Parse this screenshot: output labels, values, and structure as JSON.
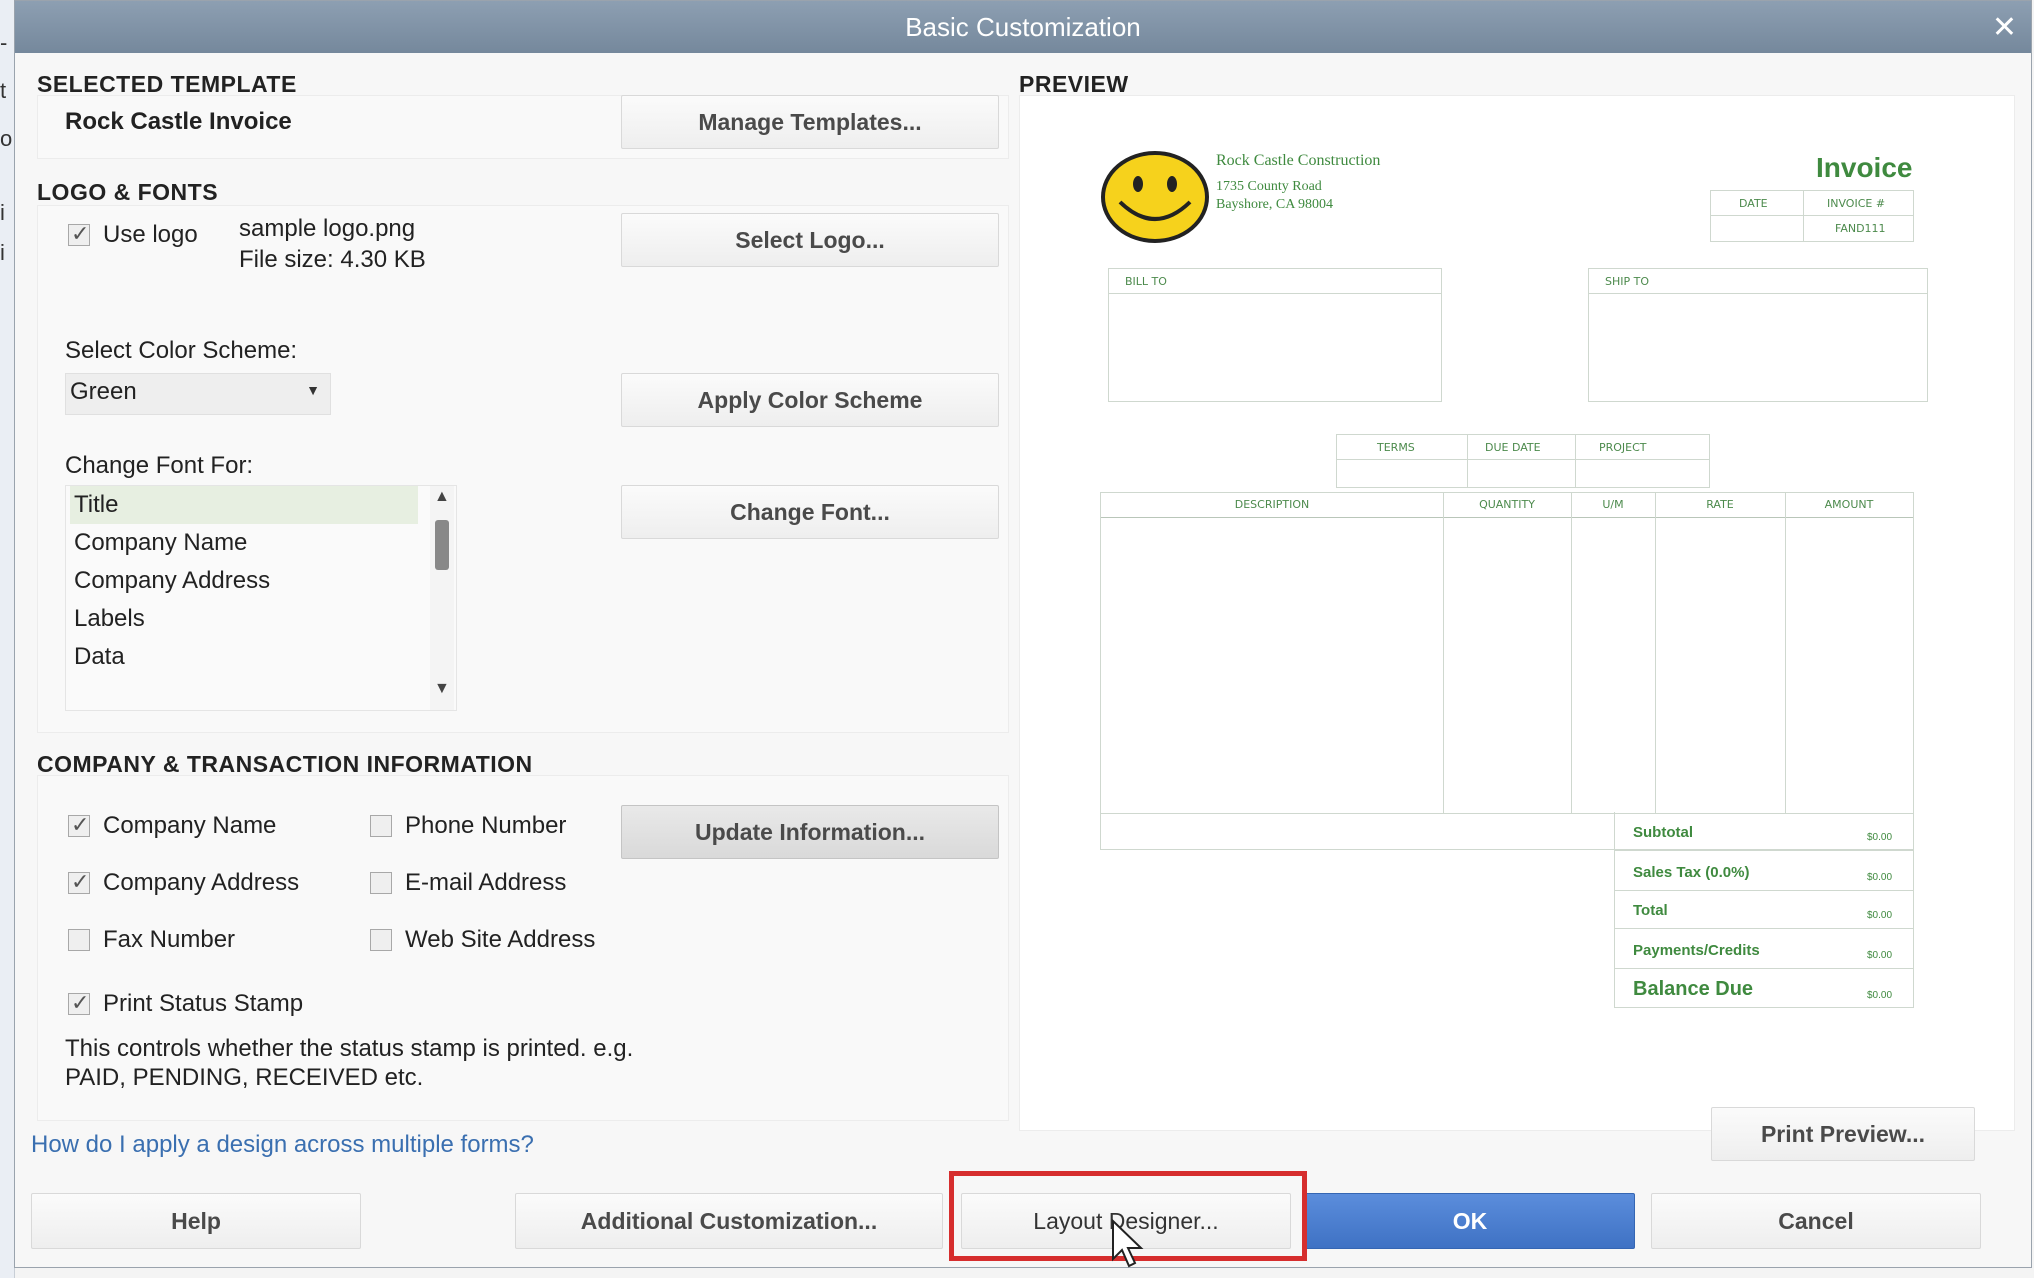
{
  "window": {
    "title": "Basic Customization"
  },
  "selected_template": {
    "heading": "SELECTED TEMPLATE",
    "name": "Rock Castle Invoice",
    "manage_button": "Manage Templates..."
  },
  "logo_fonts": {
    "heading": "LOGO & FONTS",
    "use_logo_label": "Use logo",
    "use_logo_checked": true,
    "logo_file": "sample logo.png",
    "logo_size": "File size: 4.30 KB",
    "select_logo_button": "Select Logo...",
    "color_scheme_label": "Select Color Scheme:",
    "color_scheme_value": "Green",
    "apply_color_button": "Apply Color Scheme",
    "change_font_label": "Change Font For:",
    "font_items": [
      "Title",
      "Company Name",
      "Company Address",
      "Labels",
      "Data"
    ],
    "selected_font_item": "Title",
    "change_font_button": "Change Font..."
  },
  "company_info": {
    "heading": "COMPANY & TRANSACTION INFORMATION",
    "company_name": {
      "label": "Company Name",
      "checked": true
    },
    "phone_number": {
      "label": "Phone Number",
      "checked": false
    },
    "company_address": {
      "label": "Company Address",
      "checked": true
    },
    "email_address": {
      "label": "E-mail Address",
      "checked": false
    },
    "fax_number": {
      "label": "Fax Number",
      "checked": false
    },
    "web_site": {
      "label": "Web Site Address",
      "checked": false
    },
    "update_button": "Update Information...",
    "print_status_stamp": {
      "label": "Print Status Stamp",
      "checked": true
    },
    "stamp_desc_line1": "This controls whether the status stamp is printed. e.g.",
    "stamp_desc_line2": "PAID, PENDING, RECEIVED etc."
  },
  "help_link": "How do I apply a design across multiple forms?",
  "preview": {
    "heading": "PREVIEW",
    "company_name": "Rock Castle Construction",
    "address1": "1735 County Road",
    "address2": "Bayshore, CA 98004",
    "invoice_title": "Invoice",
    "date_label": "DATE",
    "invoice_no_label": "INVOICE #",
    "invoice_no_value": "FAND111",
    "bill_to": "BILL TO",
    "ship_to": "SHIP TO",
    "terms": "TERMS",
    "due_date": "DUE DATE",
    "project": "PROJECT",
    "col_description": "DESCRIPTION",
    "col_quantity": "QUANTITY",
    "col_um": "U/M",
    "col_rate": "RATE",
    "col_amount": "AMOUNT",
    "totals": [
      {
        "label": "Subtotal",
        "value": "$0.00"
      },
      {
        "label": "Sales Tax  (0.0%)",
        "value": "$0.00"
      },
      {
        "label": "Total",
        "value": "$0.00"
      },
      {
        "label": "Payments/Credits",
        "value": "$0.00"
      },
      {
        "label": "Balance Due",
        "value": "$0.00"
      }
    ],
    "print_preview_button": "Print Preview..."
  },
  "footer": {
    "help": "Help",
    "additional": "Additional Customization...",
    "layout": "Layout Designer...",
    "ok": "OK",
    "cancel": "Cancel"
  },
  "colors": {
    "accent": "#4a7fd0",
    "invoice_green": "#3f8a3f",
    "highlight": "#d62e2e",
    "titlebar": "#8193a7"
  }
}
